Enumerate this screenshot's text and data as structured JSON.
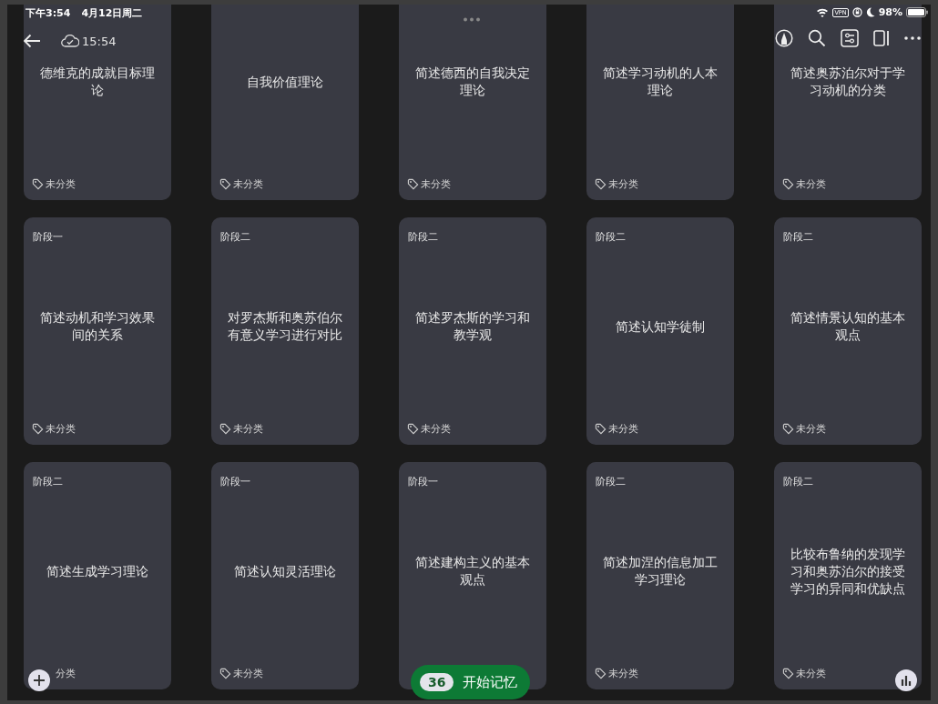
{
  "status_bar": {
    "time": "下午3:54",
    "date": "4月12日周二",
    "vpn": "VPN",
    "battery": "98%"
  },
  "toolbar": {
    "sync_time": "15:54"
  },
  "cards": [
    {
      "title": "德维克的成就目标理论",
      "tag": "未分类"
    },
    {
      "title": "自我价值理论",
      "tag": "未分类"
    },
    {
      "title": "简述德西的自我决定理论",
      "tag": "未分类"
    },
    {
      "title": "简述学习动机的人本理论",
      "tag": "未分类"
    },
    {
      "title": "简述奥苏泊尔对于学习动机的分类",
      "tag": "未分类"
    },
    {
      "stage": "阶段一",
      "title": "简述动机和学习效果间的关系",
      "tag": "未分类"
    },
    {
      "stage": "阶段二",
      "title": "对罗杰斯和奥苏伯尔有意义学习进行对比",
      "tag": "未分类"
    },
    {
      "stage": "阶段二",
      "title": "简述罗杰斯的学习和教学观",
      "tag": "未分类"
    },
    {
      "stage": "阶段二",
      "title": "简述认知学徒制",
      "tag": "未分类"
    },
    {
      "stage": "阶段二",
      "title": "简述情景认知的基本观点",
      "tag": "未分类"
    },
    {
      "stage": "阶段二",
      "title": "简述生成学习理论",
      "tag": "分类",
      "tag_icon": false
    },
    {
      "stage": "阶段一",
      "title": "简述认知灵活理论",
      "tag": "未分类"
    },
    {
      "stage": "阶段一",
      "title": "简述建构主义的基本观点"
    },
    {
      "stage": "阶段二",
      "title": "简述加涅的信息加工学习理论",
      "tag": "未分类"
    },
    {
      "stage": "阶段二",
      "title": "比较布鲁纳的发现学习和奥苏泊尔的接受学习的异同和优缺点",
      "tag": "未分类"
    }
  ],
  "start_button": {
    "count": "36",
    "label": "开始记忆"
  }
}
